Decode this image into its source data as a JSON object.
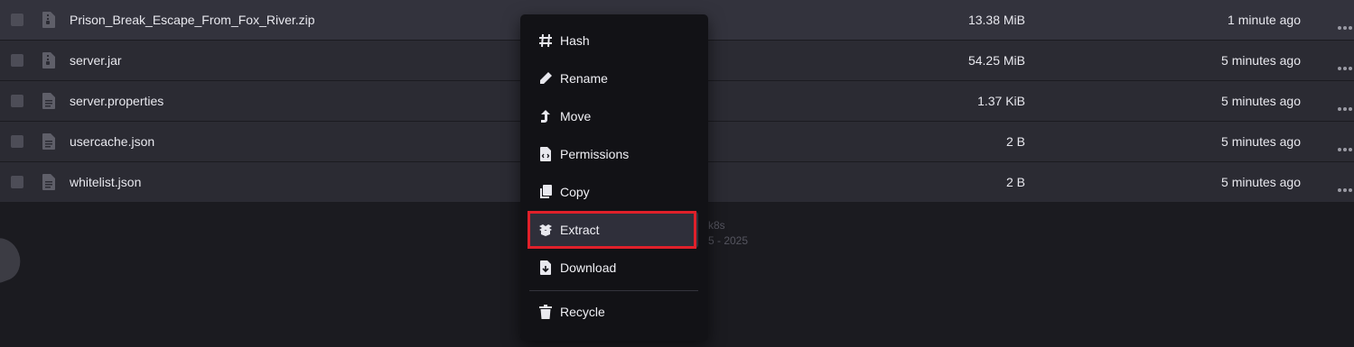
{
  "files": [
    {
      "name": "Prison_Break_Escape_From_Fox_River.zip",
      "size": "13.38 MiB",
      "modified": "1 minute ago",
      "icon": "file-archive-icon"
    },
    {
      "name": "server.jar",
      "size": "54.25 MiB",
      "modified": "5 minutes ago",
      "icon": "file-archive-icon"
    },
    {
      "name": "server.properties",
      "size": "1.37 KiB",
      "modified": "5 minutes ago",
      "icon": "file-text-icon"
    },
    {
      "name": "usercache.json",
      "size": "2 B",
      "modified": "5 minutes ago",
      "icon": "file-text-icon"
    },
    {
      "name": "whitelist.json",
      "size": "2 B",
      "modified": "5 minutes ago",
      "icon": "file-text-icon"
    }
  ],
  "footer": {
    "line1": "k8s",
    "line2": "5 - 2025"
  },
  "context_menu": {
    "items": [
      {
        "label": "Hash",
        "icon": "hash-icon"
      },
      {
        "label": "Rename",
        "icon": "pencil-icon"
      },
      {
        "label": "Move",
        "icon": "move-arrow-icon"
      },
      {
        "label": "Permissions",
        "icon": "file-code-icon"
      },
      {
        "label": "Copy",
        "icon": "copy-icon"
      },
      {
        "label": "Extract",
        "icon": "box-open-icon"
      },
      {
        "label": "Download",
        "icon": "file-download-icon"
      },
      {
        "label": "Recycle",
        "icon": "trash-icon"
      }
    ],
    "highlighted": "Extract"
  },
  "colors": {
    "highlight_border": "#e0202a",
    "menu_bg": "#121216",
    "row_bg": "#2b2b33"
  }
}
